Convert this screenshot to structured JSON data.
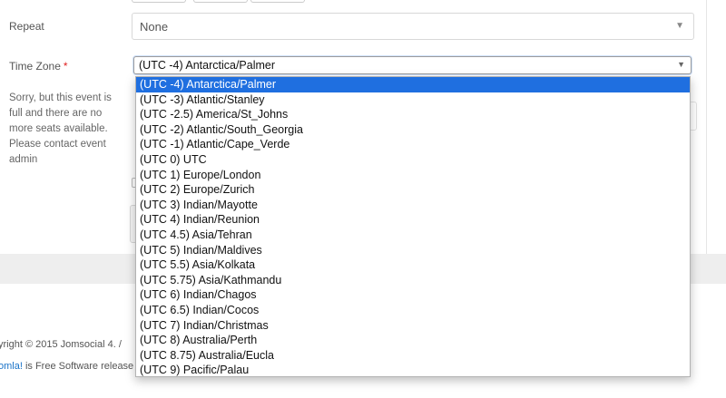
{
  "form": {
    "repeat_label": "Repeat",
    "repeat_value": "None",
    "timezone_label": "Time Zone",
    "required_mark": "*",
    "timezone_value": "(UTC -4) Antarctica/Palmer",
    "sorry_message": "Sorry, but this event is full and there are no more seats available. Please contact event admin"
  },
  "timezone_options": [
    "(UTC -4) Antarctica/Palmer",
    "(UTC -3) Atlantic/Stanley",
    "(UTC -2.5) America/St_Johns",
    "(UTC -2) Atlantic/South_Georgia",
    "(UTC -1) Atlantic/Cape_Verde",
    "(UTC 0) UTC",
    "(UTC 1) Europe/London",
    "(UTC 2) Europe/Zurich",
    "(UTC 3) Indian/Mayotte",
    "(UTC 4) Indian/Reunion",
    "(UTC 4.5) Asia/Tehran",
    "(UTC 5) Indian/Maldives",
    "(UTC 5.5) Asia/Kolkata",
    "(UTC 5.75) Asia/Kathmandu",
    "(UTC 6) Indian/Chagos",
    "(UTC 6.5) Indian/Cocos",
    "(UTC 7) Indian/Christmas",
    "(UTC 8) Australia/Perth",
    "(UTC 8.75) Australia/Eucla",
    "(UTC 9) Pacific/Palau"
  ],
  "selected_index": 0,
  "footer": {
    "copyright": "yright © 2015 Jomsocial 4. /",
    "joomla_link": "omla!",
    "free_software_text": " is Free Software release"
  },
  "colors": {
    "selection": "#1f6fe0",
    "required": "#e02020",
    "link": "#1a73c8"
  }
}
